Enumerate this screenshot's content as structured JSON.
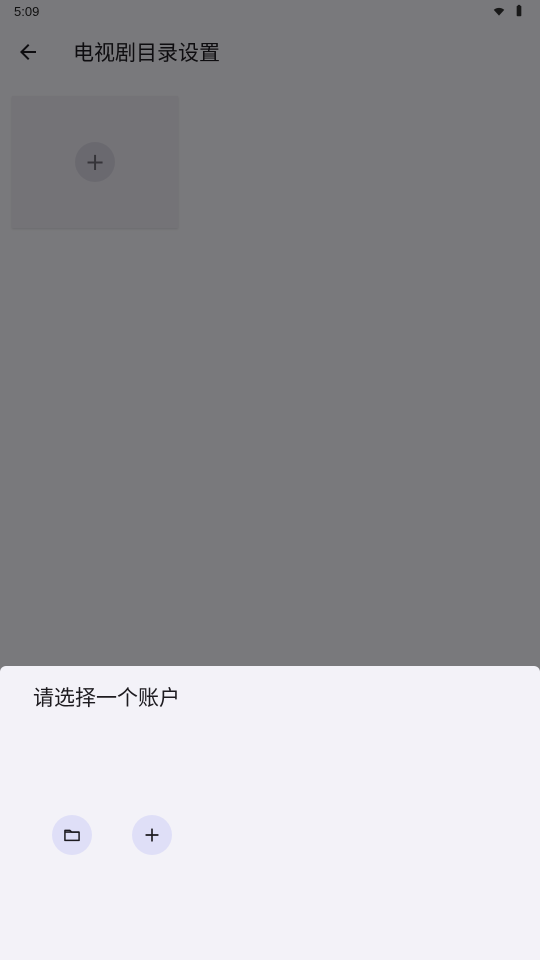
{
  "status_bar": {
    "time": "5:09",
    "wifi_icon": "wifi-icon",
    "battery_icon": "battery-icon"
  },
  "app_bar": {
    "back_icon": "arrow-left-icon",
    "title": "电视剧目录设置"
  },
  "grid": {
    "add_icon": "plus-icon"
  },
  "bottom_sheet": {
    "title": "请选择一个账户",
    "actions": [
      {
        "icon": "folder-icon"
      },
      {
        "icon": "plus-icon"
      }
    ]
  },
  "colors": {
    "background": "#f3f2f8",
    "scrim": "rgba(0,0,0,0.5)",
    "action_background": "#dfdff7",
    "text": "#1d1b20"
  }
}
